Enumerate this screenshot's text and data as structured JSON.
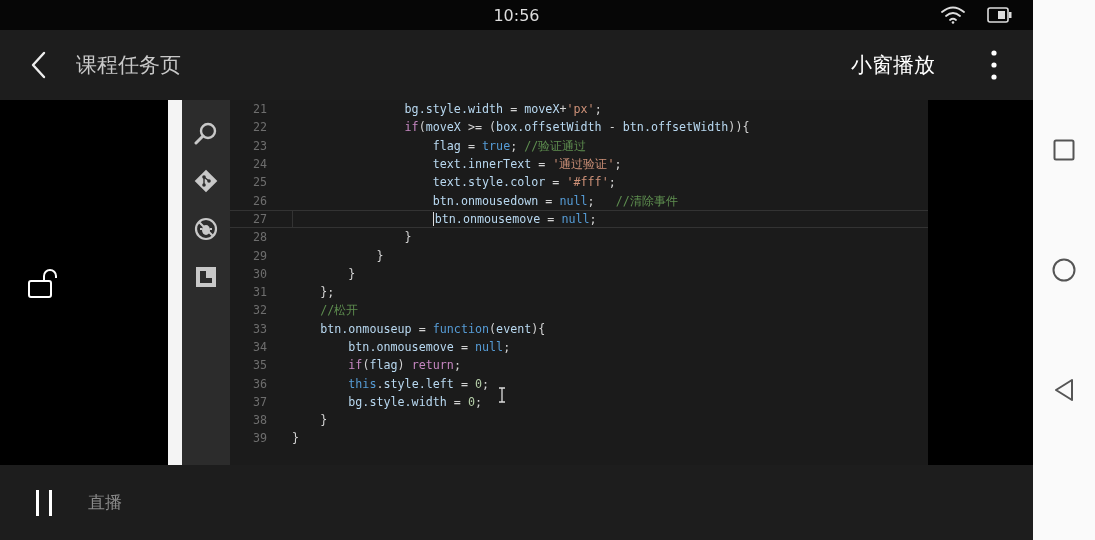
{
  "status_bar": {
    "time": "10:56"
  },
  "top_bar": {
    "title": "课程任务页",
    "action": "小窗播放"
  },
  "player": {
    "locked": false,
    "editor": {
      "lines": [
        {
          "number": "21",
          "current": false,
          "tokens": [
            {
              "kind": "var",
              "text": "                bg.style.width"
            },
            {
              "kind": "plain",
              "text": " = "
            },
            {
              "kind": "var",
              "text": "moveX"
            },
            {
              "kind": "plain",
              "text": "+"
            },
            {
              "kind": "string",
              "text": "'px'"
            },
            {
              "kind": "plain",
              "text": ";"
            }
          ]
        },
        {
          "number": "22",
          "current": false,
          "tokens": [
            {
              "kind": "keyword",
              "text": "                if"
            },
            {
              "kind": "plain",
              "text": "("
            },
            {
              "kind": "var",
              "text": "moveX"
            },
            {
              "kind": "plain",
              "text": " >= ("
            },
            {
              "kind": "var",
              "text": "box.offsetWidth"
            },
            {
              "kind": "plain",
              "text": " - "
            },
            {
              "kind": "var",
              "text": "btn.offsetWidth"
            },
            {
              "kind": "plain",
              "text": ")){"
            }
          ]
        },
        {
          "number": "23",
          "current": false,
          "tokens": [
            {
              "kind": "var",
              "text": "                    flag"
            },
            {
              "kind": "plain",
              "text": " = "
            },
            {
              "kind": "const",
              "text": "true"
            },
            {
              "kind": "plain",
              "text": "; "
            },
            {
              "kind": "comment",
              "text": "//验证通过"
            }
          ]
        },
        {
          "number": "24",
          "current": false,
          "tokens": [
            {
              "kind": "var",
              "text": "                    text.innerText"
            },
            {
              "kind": "plain",
              "text": " = "
            },
            {
              "kind": "string",
              "text": "'通过验证'"
            },
            {
              "kind": "plain",
              "text": ";"
            }
          ]
        },
        {
          "number": "25",
          "current": false,
          "tokens": [
            {
              "kind": "var",
              "text": "                    text.style.color"
            },
            {
              "kind": "plain",
              "text": " = "
            },
            {
              "kind": "string",
              "text": "'#fff'"
            },
            {
              "kind": "plain",
              "text": ";"
            }
          ]
        },
        {
          "number": "26",
          "current": false,
          "tokens": [
            {
              "kind": "var",
              "text": "                    btn.onmousedown"
            },
            {
              "kind": "plain",
              "text": " = "
            },
            {
              "kind": "const",
              "text": "null"
            },
            {
              "kind": "plain",
              "text": ";   "
            },
            {
              "kind": "comment",
              "text": "//清除事件"
            }
          ]
        },
        {
          "number": "27",
          "current": true,
          "tokens": [
            {
              "kind": "var",
              "text": "                    btn.onmousemove"
            },
            {
              "kind": "plain",
              "text": " = "
            },
            {
              "kind": "const",
              "text": "null"
            },
            {
              "kind": "plain",
              "text": ";"
            }
          ]
        },
        {
          "number": "28",
          "current": false,
          "tokens": [
            {
              "kind": "plain",
              "text": "                }"
            }
          ]
        },
        {
          "number": "29",
          "current": false,
          "tokens": [
            {
              "kind": "plain",
              "text": "            }"
            }
          ]
        },
        {
          "number": "30",
          "current": false,
          "tokens": [
            {
              "kind": "plain",
              "text": "        }"
            }
          ]
        },
        {
          "number": "31",
          "current": false,
          "tokens": [
            {
              "kind": "plain",
              "text": "    };"
            }
          ]
        },
        {
          "number": "32",
          "current": false,
          "tokens": [
            {
              "kind": "comment",
              "text": "    //松开"
            }
          ]
        },
        {
          "number": "33",
          "current": false,
          "tokens": [
            {
              "kind": "var",
              "text": "    btn.onmouseup"
            },
            {
              "kind": "plain",
              "text": " = "
            },
            {
              "kind": "const",
              "text": "function"
            },
            {
              "kind": "plain",
              "text": "("
            },
            {
              "kind": "var",
              "text": "event"
            },
            {
              "kind": "plain",
              "text": "){"
            }
          ]
        },
        {
          "number": "34",
          "current": false,
          "tokens": [
            {
              "kind": "var",
              "text": "        btn.onmousemove"
            },
            {
              "kind": "plain",
              "text": " = "
            },
            {
              "kind": "const",
              "text": "null"
            },
            {
              "kind": "plain",
              "text": ";"
            }
          ]
        },
        {
          "number": "35",
          "current": false,
          "tokens": [
            {
              "kind": "keyword",
              "text": "        if"
            },
            {
              "kind": "plain",
              "text": "("
            },
            {
              "kind": "var",
              "text": "flag"
            },
            {
              "kind": "plain",
              "text": ") "
            },
            {
              "kind": "keyword",
              "text": "return"
            },
            {
              "kind": "plain",
              "text": ";"
            }
          ]
        },
        {
          "number": "36",
          "current": false,
          "tokens": [
            {
              "kind": "const",
              "text": "        this"
            },
            {
              "kind": "plain",
              "text": "."
            },
            {
              "kind": "var",
              "text": "style.left"
            },
            {
              "kind": "plain",
              "text": " = "
            },
            {
              "kind": "number",
              "text": "0"
            },
            {
              "kind": "plain",
              "text": ";"
            }
          ]
        },
        {
          "number": "37",
          "current": false,
          "tokens": [
            {
              "kind": "var",
              "text": "        bg.style.width"
            },
            {
              "kind": "plain",
              "text": " = "
            },
            {
              "kind": "number",
              "text": "0"
            },
            {
              "kind": "plain",
              "text": ";"
            }
          ]
        },
        {
          "number": "38",
          "current": false,
          "tokens": [
            {
              "kind": "plain",
              "text": "    }"
            }
          ]
        },
        {
          "number": "39",
          "current": false,
          "tokens": [
            {
              "kind": "plain",
              "text": "}"
            }
          ]
        }
      ]
    }
  },
  "bottom_bar": {
    "playing": true,
    "label": "直播"
  }
}
